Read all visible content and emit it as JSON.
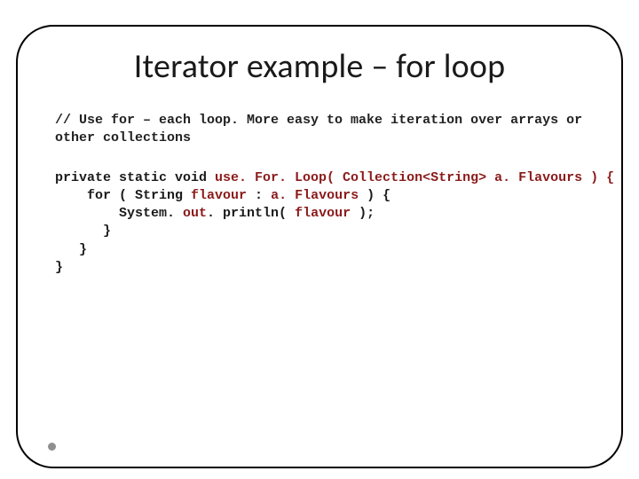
{
  "title": "Iterator example – for loop",
  "comment": "// Use for – each loop. More easy to make iteration over arrays or other collections",
  "code": {
    "line1a": "private static void ",
    "line1b": "use. For. Loop( Collection<String> a. Flavours ) {",
    "line2a": "    for ( String ",
    "line2b": "flavour",
    "line2c": " : ",
    "line2d": "a. Flavours",
    "line2e": " ) {",
    "line3a": "        System. ",
    "line3b": "out",
    "line3c": ". println( ",
    "line3d": "flavour",
    "line3e": " );",
    "line4": "      }",
    "line5": "   }",
    "line6": "}"
  }
}
